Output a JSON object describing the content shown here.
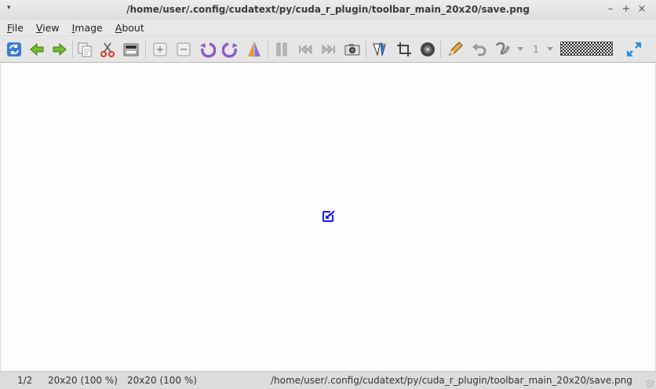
{
  "window": {
    "title": "/home/user/.config/cudatext/py/cuda_r_plugin/toolbar_main_20x20/save.png",
    "menu_arrow": "▾",
    "minimize": "–",
    "maximize": "+",
    "close": "×"
  },
  "menu": [
    "File",
    "View",
    "Image",
    "About"
  ],
  "toolbar": {
    "page_value": "1",
    "color": "#111111",
    "icons": [
      "refresh-icon",
      "back-arrow-icon",
      "forward-arrow-icon",
      "copy-icon",
      "cut-icon",
      "scanner-icon",
      "zoom-in-icon",
      "zoom-out-icon",
      "rotate-left-icon",
      "rotate-right-icon",
      "flip-icon",
      "pause-icon",
      "skip-back-icon",
      "skip-forward-icon",
      "camera-icon",
      "color-adjust-icon",
      "crop-icon",
      "disc-icon",
      "pencil-icon",
      "undo-icon",
      "hand-tool-icon",
      "page-dropdown-icon",
      "fullscreen-icon"
    ]
  },
  "canvas": {
    "image_icon": "save-icon",
    "accent": "#1a1aff"
  },
  "status": {
    "page": "1/2",
    "image_size": "20x20 (100 %)",
    "view_size": "20x20 (100 %)",
    "path": "/home/user/.config/cudatext/py/cuda_r_plugin/toolbar_main_20x20/save.png"
  }
}
